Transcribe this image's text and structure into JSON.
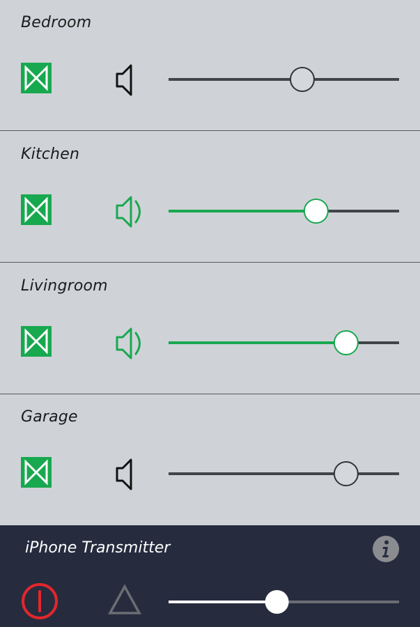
{
  "colors": {
    "accent": "#18a84f",
    "track": "#424548",
    "panel": "#cfd3d8",
    "transmitter_bg": "#262c3e",
    "power": "#e3262d"
  },
  "zones": [
    {
      "name": "Bedroom",
      "volume": 0.58,
      "active": false,
      "speaker_icon": "speaker-muted-icon"
    },
    {
      "name": "Kitchen",
      "volume": 0.64,
      "active": true,
      "speaker_icon": "speaker-on-icon"
    },
    {
      "name": "Livingroom",
      "volume": 0.77,
      "active": true,
      "speaker_icon": "speaker-on-icon"
    },
    {
      "name": "Garage",
      "volume": 0.77,
      "active": false,
      "speaker_icon": "speaker-muted-icon"
    }
  ],
  "transmitter": {
    "title": "iPhone Transmitter",
    "volume": 0.47,
    "icons": [
      "info-icon",
      "power-icon",
      "warning-triangle-icon"
    ]
  }
}
